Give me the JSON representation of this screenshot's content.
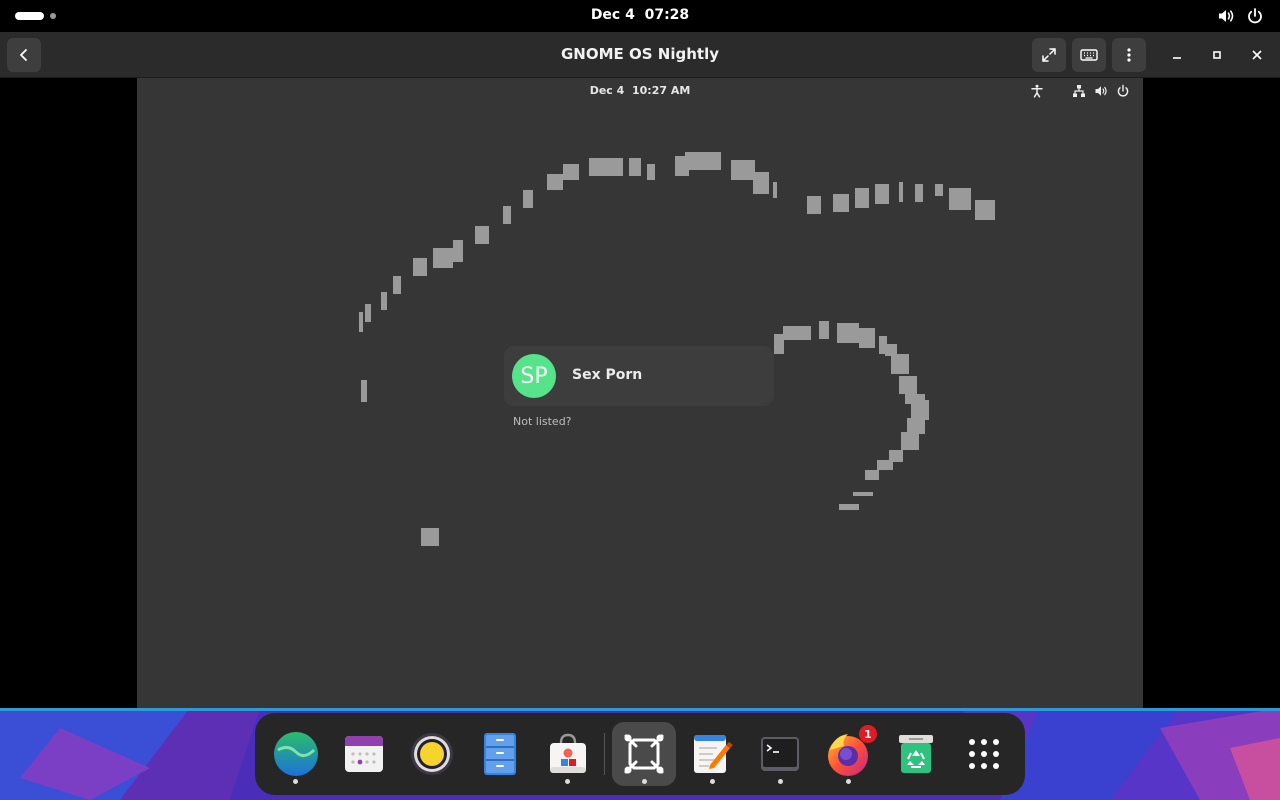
{
  "host_topbar": {
    "date": "Dec 4",
    "time": "07:28",
    "icons": [
      "volume-icon",
      "power-icon"
    ]
  },
  "window": {
    "title": "GNOME OS Nightly",
    "buttons": [
      "back-button",
      "fullscreen-button",
      "keyboard-button",
      "menu-button",
      "minimize-button",
      "maximize-button",
      "close-button"
    ]
  },
  "vm": {
    "date": "Dec 4",
    "time": "10:27 AM",
    "status_icons": [
      "accessibility-icon",
      "network-icon",
      "volume-icon",
      "power-icon"
    ],
    "user": {
      "initials": "SP",
      "name": "Sex Porn",
      "avatar_color": "#57e389"
    },
    "not_listed": "Not listed?"
  },
  "dock": {
    "apps": [
      {
        "name": "Web",
        "icon": "globe-icon",
        "running": true
      },
      {
        "name": "Calendar",
        "icon": "calendar-icon",
        "running": false
      },
      {
        "name": "Rhythmbox",
        "icon": "speaker-icon",
        "running": false
      },
      {
        "name": "Files",
        "icon": "file-cabinet-icon",
        "running": false
      },
      {
        "name": "Software",
        "icon": "shopping-bag-icon",
        "running": true
      },
      {
        "name": "Boxes",
        "icon": "boxes-icon",
        "running": true,
        "active": true
      },
      {
        "name": "Text Editor",
        "icon": "text-editor-icon",
        "running": true
      },
      {
        "name": "Terminal",
        "icon": "terminal-icon",
        "running": true
      },
      {
        "name": "Firefox",
        "icon": "firefox-icon",
        "running": true,
        "badge": "1"
      },
      {
        "name": "Trash",
        "icon": "recycle-icon",
        "running": false
      },
      {
        "name": "Show Apps",
        "icon": "app-grid-icon",
        "running": false
      }
    ]
  },
  "colors": {
    "vm_background": "#363636",
    "header_bg": "#2b2b2b",
    "accent_green": "#57e389",
    "badge_red": "#e01b24"
  }
}
